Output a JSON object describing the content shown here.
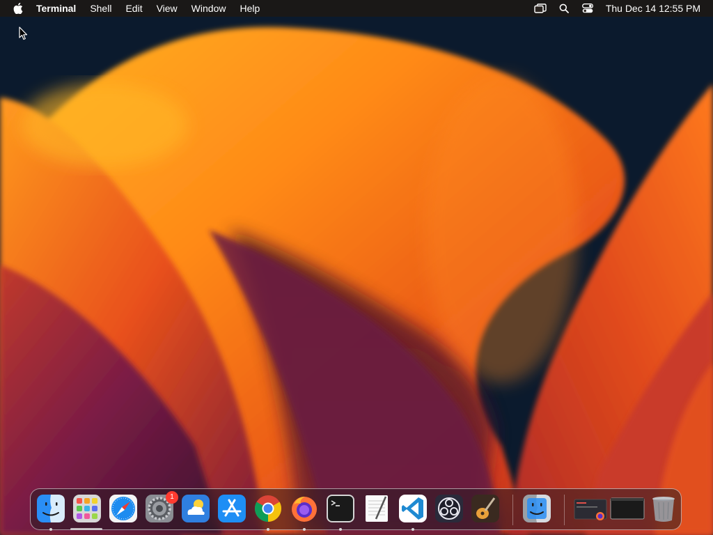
{
  "menubar": {
    "apple_icon": "apple-icon",
    "app_name": "Terminal",
    "menus": [
      "Shell",
      "Edit",
      "View",
      "Window",
      "Help"
    ],
    "status_icons": [
      "stage-manager-icon",
      "spotlight-search-icon",
      "control-center-icon"
    ],
    "clock": "Thu Dec 14  12:55 PM"
  },
  "dock": {
    "apps": [
      {
        "name": "Finder",
        "icon": "finder-icon",
        "running": true
      },
      {
        "name": "Launchpad",
        "icon": "launchpad-icon",
        "running": false
      },
      {
        "name": "Safari",
        "icon": "safari-icon",
        "running": false
      },
      {
        "name": "System Settings",
        "icon": "system-settings-icon",
        "running": false,
        "badge": "1"
      },
      {
        "name": "Weather",
        "icon": "weather-icon",
        "running": false
      },
      {
        "name": "App Store",
        "icon": "app-store-icon",
        "running": false
      },
      {
        "name": "Google Chrome",
        "icon": "chrome-icon",
        "running": true
      },
      {
        "name": "Firefox",
        "icon": "firefox-icon",
        "running": true
      },
      {
        "name": "Terminal",
        "icon": "terminal-icon",
        "running": true
      },
      {
        "name": "TextEdit",
        "icon": "textedit-icon",
        "running": false
      },
      {
        "name": "Visual Studio Code",
        "icon": "vscode-icon",
        "running": true
      },
      {
        "name": "OBS",
        "icon": "obs-icon",
        "running": false
      },
      {
        "name": "GarageBand",
        "icon": "garageband-icon",
        "running": false
      }
    ],
    "recent": [
      {
        "name": "Finder",
        "icon": "finder-icon"
      }
    ],
    "minimized": [
      {
        "name": "Firefox window",
        "icon": "minimized-firefox-window-icon"
      },
      {
        "name": "Terminal window",
        "icon": "minimized-terminal-window-icon"
      }
    ],
    "trash": {
      "name": "Trash",
      "icon": "trash-icon"
    }
  },
  "colors": {
    "wallpaper_orange": "#ff7a1a",
    "wallpaper_red": "#d6381a",
    "wallpaper_purple": "#6e1e45",
    "wallpaper_navy": "#0a1a2e",
    "badge_red": "#ff3b30"
  }
}
